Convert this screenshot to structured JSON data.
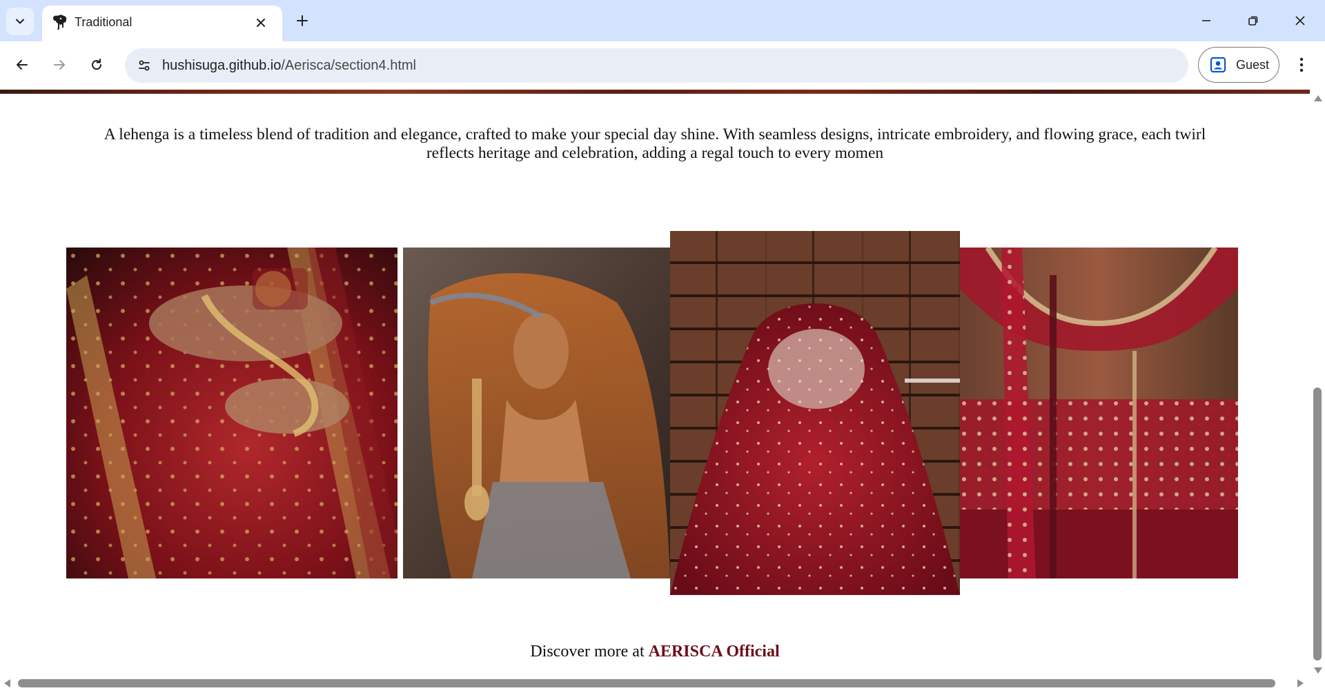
{
  "browser": {
    "tab": {
      "title": "Traditional",
      "favicon": "elephant-icon"
    },
    "address_bar": {
      "host": "hushisuga.github.io",
      "path": "/Aerisca/section4.html"
    },
    "profile": {
      "label": "Guest",
      "icon": "person-badge-icon"
    },
    "icons": {
      "tab_search": "chevron-down-icon",
      "close_tab": "close-icon",
      "new_tab": "plus-icon",
      "minimize": "minimize-icon",
      "restore": "restore-icon",
      "close_window": "close-icon",
      "back": "arrow-left-icon",
      "forward": "arrow-right-icon",
      "reload": "reload-icon",
      "site_info": "tune-icon",
      "menu": "kebab-menu-icon"
    }
  },
  "page": {
    "intro": "A lehenga is a timeless blend of tradition and elegance, crafted to make your special day shine. With seamless designs, intricate embroidery, and flowing grace, each twirl reflects heritage and celebration, adding a regal touch to every momen",
    "gallery": [
      {
        "name": "photo-hands-jewelry",
        "palette": [
          "#2a0a0c",
          "#7a1018",
          "#b0282c",
          "#c8a050"
        ]
      },
      {
        "name": "photo-bride-veil",
        "palette": [
          "#3a2a22",
          "#8a4a22",
          "#c26a2a",
          "#d9b070"
        ]
      },
      {
        "name": "photo-bride-red-dupatta",
        "palette": [
          "#3a2218",
          "#6a3a28",
          "#8a1020",
          "#c8a098"
        ]
      },
      {
        "name": "photo-blouse-back",
        "palette": [
          "#5a3a28",
          "#9a5a40",
          "#a0182a",
          "#d8c090"
        ]
      }
    ],
    "discover": {
      "prefix": "Discover more at ",
      "brand": "AERISCA Official"
    },
    "colors": {
      "brand": "#6b0f1a",
      "chrome": "#d3e3fd"
    }
  }
}
